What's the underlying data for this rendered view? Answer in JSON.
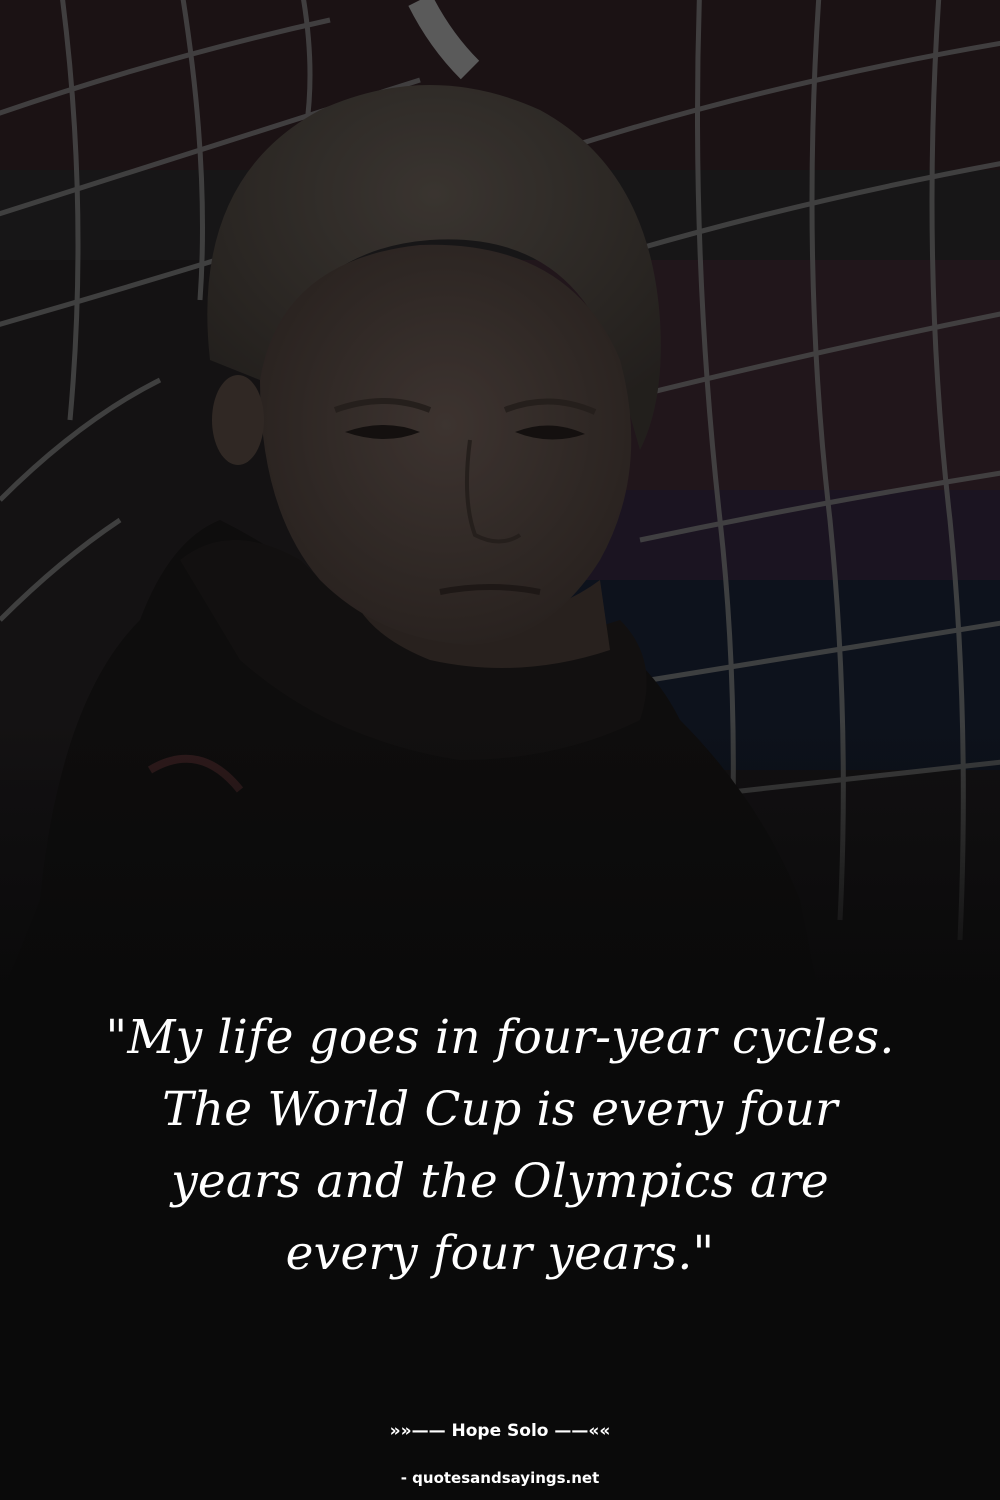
{
  "quote": {
    "text": "\"My life goes in four-year cycles. The World Cup is every four years and the Olympics are every four years.\"",
    "author_line": "»»—— Hope Solo ——««",
    "source": "- quotesandsayings.net"
  },
  "background": {
    "subject": "goalkeeper-portrait-behind-net",
    "colors": {
      "base": "#0a0a0a",
      "net": "#6d6d6d",
      "stand_red": "#3a1f24",
      "stand_blue": "#172235",
      "skin": "#5a4c45",
      "hair": "#4e463f",
      "jacket": "#161414",
      "text": "#ffffff"
    }
  }
}
